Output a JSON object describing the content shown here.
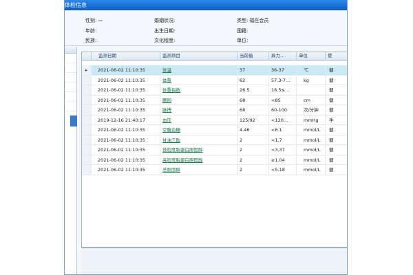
{
  "window": {
    "title": "体检信息"
  },
  "info": {
    "gender": {
      "label": "性别:",
      "value": "—"
    },
    "marital": {
      "label": "婚姻状况:",
      "value": ""
    },
    "type": {
      "label": "类型:",
      "value": "福在会员"
    },
    "age": {
      "label": "年龄:",
      "value": ""
    },
    "birthday": {
      "label": "出生日期:",
      "value": ""
    },
    "nationality": {
      "label": "国籍:",
      "value": ""
    },
    "ethnicity": {
      "label": "民族:",
      "value": ""
    },
    "education": {
      "label": "文化程度:",
      "value": ""
    },
    "unit": {
      "label": "单位:",
      "value": ""
    }
  },
  "grid": {
    "columns": [
      "",
      "监测日期",
      "监测项目",
      "当前值",
      "异力…",
      "单位",
      "使"
    ],
    "rows": [
      {
        "marker": "▸",
        "date": "2021-06-02 11:10:35",
        "item": "体温",
        "value": "37",
        "range": "36-37",
        "unit": "℃",
        "flag": "健"
      },
      {
        "marker": "",
        "date": "2021-06-02 11:10:35",
        "item": "体重",
        "value": "62",
        "range": "57.3-7…",
        "unit": "kg",
        "flag": "健"
      },
      {
        "marker": "",
        "date": "2021-06-02 11:10:35",
        "item": "体重指数",
        "value": "26.5",
        "range": "18.5≤…",
        "unit": "",
        "flag": "健"
      },
      {
        "marker": "",
        "date": "2021-06-02 11:10:35",
        "item": "腰围",
        "value": "68",
        "range": "<85",
        "unit": "cm",
        "flag": "健"
      },
      {
        "marker": "",
        "date": "2021-06-02 11:10:35",
        "item": "脉搏",
        "value": "68",
        "range": "60-100",
        "unit": "次/分钟",
        "flag": "健"
      },
      {
        "marker": "",
        "date": "2019-12-16 21:40:17",
        "item": "血压",
        "value": "125/92",
        "range": "<120…",
        "unit": "mmHg",
        "flag": "手"
      },
      {
        "marker": "",
        "date": "2021-06-02 11:10:35",
        "item": "空腹血糖",
        "value": "4.46",
        "range": "<6.1",
        "unit": "mmol/L",
        "flag": "健"
      },
      {
        "marker": "",
        "date": "2021-06-02 11:10:35",
        "item": "甘油三酯",
        "value": "2",
        "range": "<1.7",
        "unit": "mmol/L",
        "flag": "健"
      },
      {
        "marker": "",
        "date": "2021-06-02 11:10:35",
        "item": "低密度脂蛋白胆固醇",
        "value": "2",
        "range": "<3.37",
        "unit": "mmol/L",
        "flag": "健"
      },
      {
        "marker": "",
        "date": "2021-06-02 11:10:35",
        "item": "高密度脂蛋白胆固醇",
        "value": "2",
        "range": "≥1.04",
        "unit": "mmol/L",
        "flag": "健"
      },
      {
        "marker": "",
        "date": "2021-06-02 11:10:35",
        "item": "总胆固醇",
        "value": "2",
        "range": "<5.18",
        "unit": "mmol/L",
        "flag": "健"
      }
    ]
  },
  "colors": {
    "title_bar": "#1a6fd8",
    "selected_row": "#c9e9f4",
    "link_text": "#1b7a4a",
    "accent": "#2b6cc4"
  }
}
